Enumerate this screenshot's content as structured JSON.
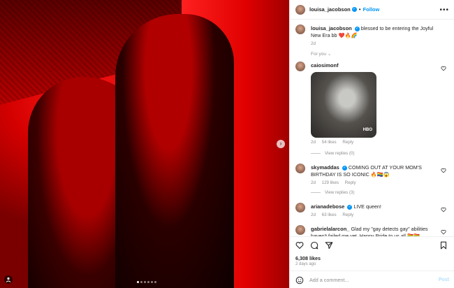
{
  "post": {
    "author": "louisa_jacobson",
    "follow_label": "Follow",
    "separator": "•",
    "caption": "blessed to be entering the Joyful New Era bb ❤️🔥🌈",
    "caption_time": "2d",
    "section_label": "For you",
    "likes": "6,308 likes",
    "posted": "2 days ago",
    "next_label": "›",
    "slide_count": 6,
    "active_slide": 0
  },
  "comments": [
    {
      "user": "caiosimonf",
      "text": "",
      "time": "2d",
      "likes": "54 likes",
      "reply": "Reply",
      "view_replies": "View replies (0)",
      "gif_badge": "HBO"
    },
    {
      "user": "skymaddas",
      "text": "COMING OUT AT YOUR MOM'S BIRTHDAY IS SO ICONIC 🔥🏳️‍🌈😱",
      "time": "2d",
      "likes": "129 likes",
      "reply": "Reply",
      "view_replies": "View replies (3)"
    },
    {
      "user": "arianadebose",
      "text": "LIVE queen!",
      "time": "2d",
      "likes": "63 likes",
      "reply": "Reply"
    },
    {
      "user": "gabrielalarcon_",
      "text": "Glad my \"gay detects gay\" abilities haven't failed me yet. Happy Pride to us all 🏳️‍🌈🏳️‍🌈"
    }
  ],
  "composer": {
    "placeholder": "Add a comment...",
    "post_label": "Post"
  },
  "colors": {
    "accent": "#0095f6",
    "muted": "#8e8e8e",
    "like_red": "#ed4956"
  },
  "icons": [
    "heart-icon",
    "comment-icon",
    "share-icon",
    "bookmark-icon",
    "more-icon",
    "emoji-icon",
    "tag-icon",
    "chevron-right-icon",
    "verified-badge"
  ]
}
